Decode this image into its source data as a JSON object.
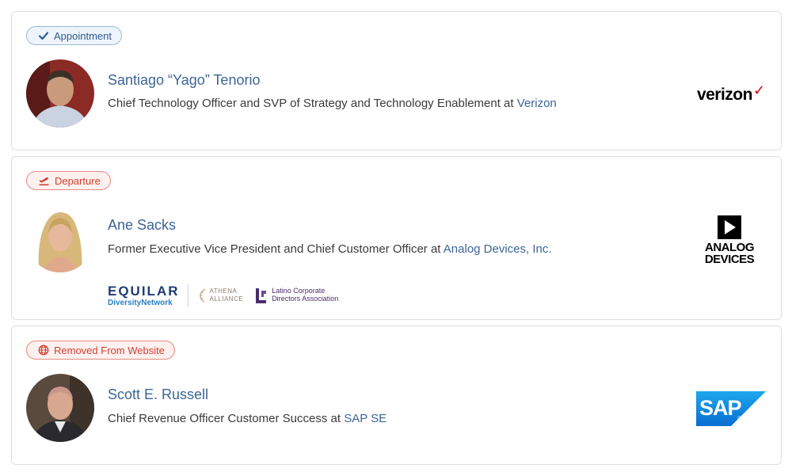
{
  "cards": [
    {
      "badge": {
        "label": "Appointment",
        "icon": "check-icon",
        "color": "#2f5b8f"
      },
      "person": {
        "name": "Santiago “Yago” Tenorio",
        "title_prefix": "Chief Technology Officer and SVP of Strategy and Technology Enablement at ",
        "company": "Verizon"
      },
      "logo": {
        "text": "verizon",
        "mark": "✓",
        "accent": "#cd040b"
      }
    },
    {
      "badge": {
        "label": "Departure",
        "icon": "plane-departure-icon",
        "color": "#d13f31"
      },
      "person": {
        "name": "Ane Sacks",
        "title_prefix": "Former Executive Vice President and Chief Customer Officer at ",
        "company": "Analog Devices, Inc."
      },
      "logo": {
        "line1": "ANALOG",
        "line2": "DEVICES"
      },
      "organizations": {
        "equilar_big": "EQUILAR",
        "equilar_small": "DiversityNetwork",
        "athena_line1": "ATHENA",
        "athena_line2": "ALLIANCE",
        "latino_line1": "Latino Corporate",
        "latino_line2": "Directors Association"
      }
    },
    {
      "badge": {
        "label": "Removed From Website",
        "icon": "globe-icon",
        "color": "#d13f31"
      },
      "person": {
        "name": "Scott E. Russell",
        "title_prefix": "Chief Revenue Officer Customer Success at ",
        "company": "SAP SE"
      },
      "logo": {
        "text": "SAP",
        "mark": "®",
        "accent": "#0a6ed1"
      }
    }
  ]
}
